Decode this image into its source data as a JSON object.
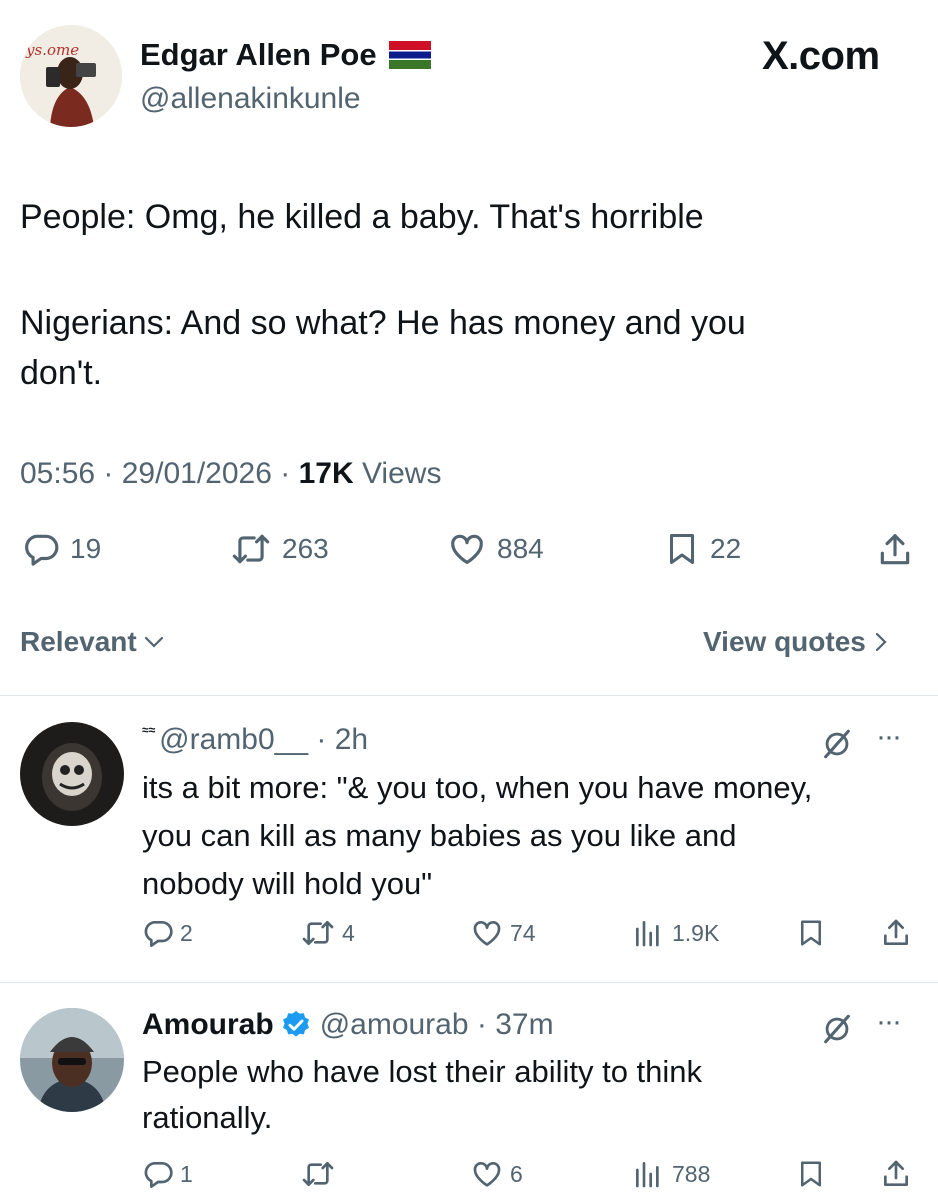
{
  "author": {
    "name": "Edgar Allen Poe",
    "handle": "@allenakinkunle",
    "avatar_text": "ys.ome"
  },
  "brand": "X.com",
  "post": {
    "line1": "People: Omg, he killed a baby. That's horrible",
    "line2": "Nigerians: And so what? He has money and you",
    "line3": "don't.",
    "time": "05:56",
    "date": "29/01/2026",
    "views_count": "17K",
    "views_label": "Views",
    "replies": "19",
    "reposts": "263",
    "likes": "884",
    "bookmarks": "22"
  },
  "sort_label": "Relevant",
  "view_quotes_label": "View quotes",
  "replies": [
    {
      "name_glyph": "≈≈",
      "handle": "@ramb0__",
      "time": "2h",
      "lines": [
        "its a bit more: \"& you too, when you have money,",
        "you can kill as many babies as you like and",
        "nobody will hold you\""
      ],
      "replies": "2",
      "reposts": "4",
      "likes": "74",
      "views": "1.9K"
    },
    {
      "name": "Amourab",
      "handle": "@amourab",
      "time": "37m",
      "lines": [
        "People who have lost their ability to think",
        "rationally."
      ],
      "replies": "1",
      "reposts": "",
      "likes": "6",
      "views": "788"
    }
  ],
  "colors": {
    "text": "#0f1419",
    "muted": "#536471",
    "verified": "#1d9bf0",
    "divider": "#e1e6ea"
  }
}
